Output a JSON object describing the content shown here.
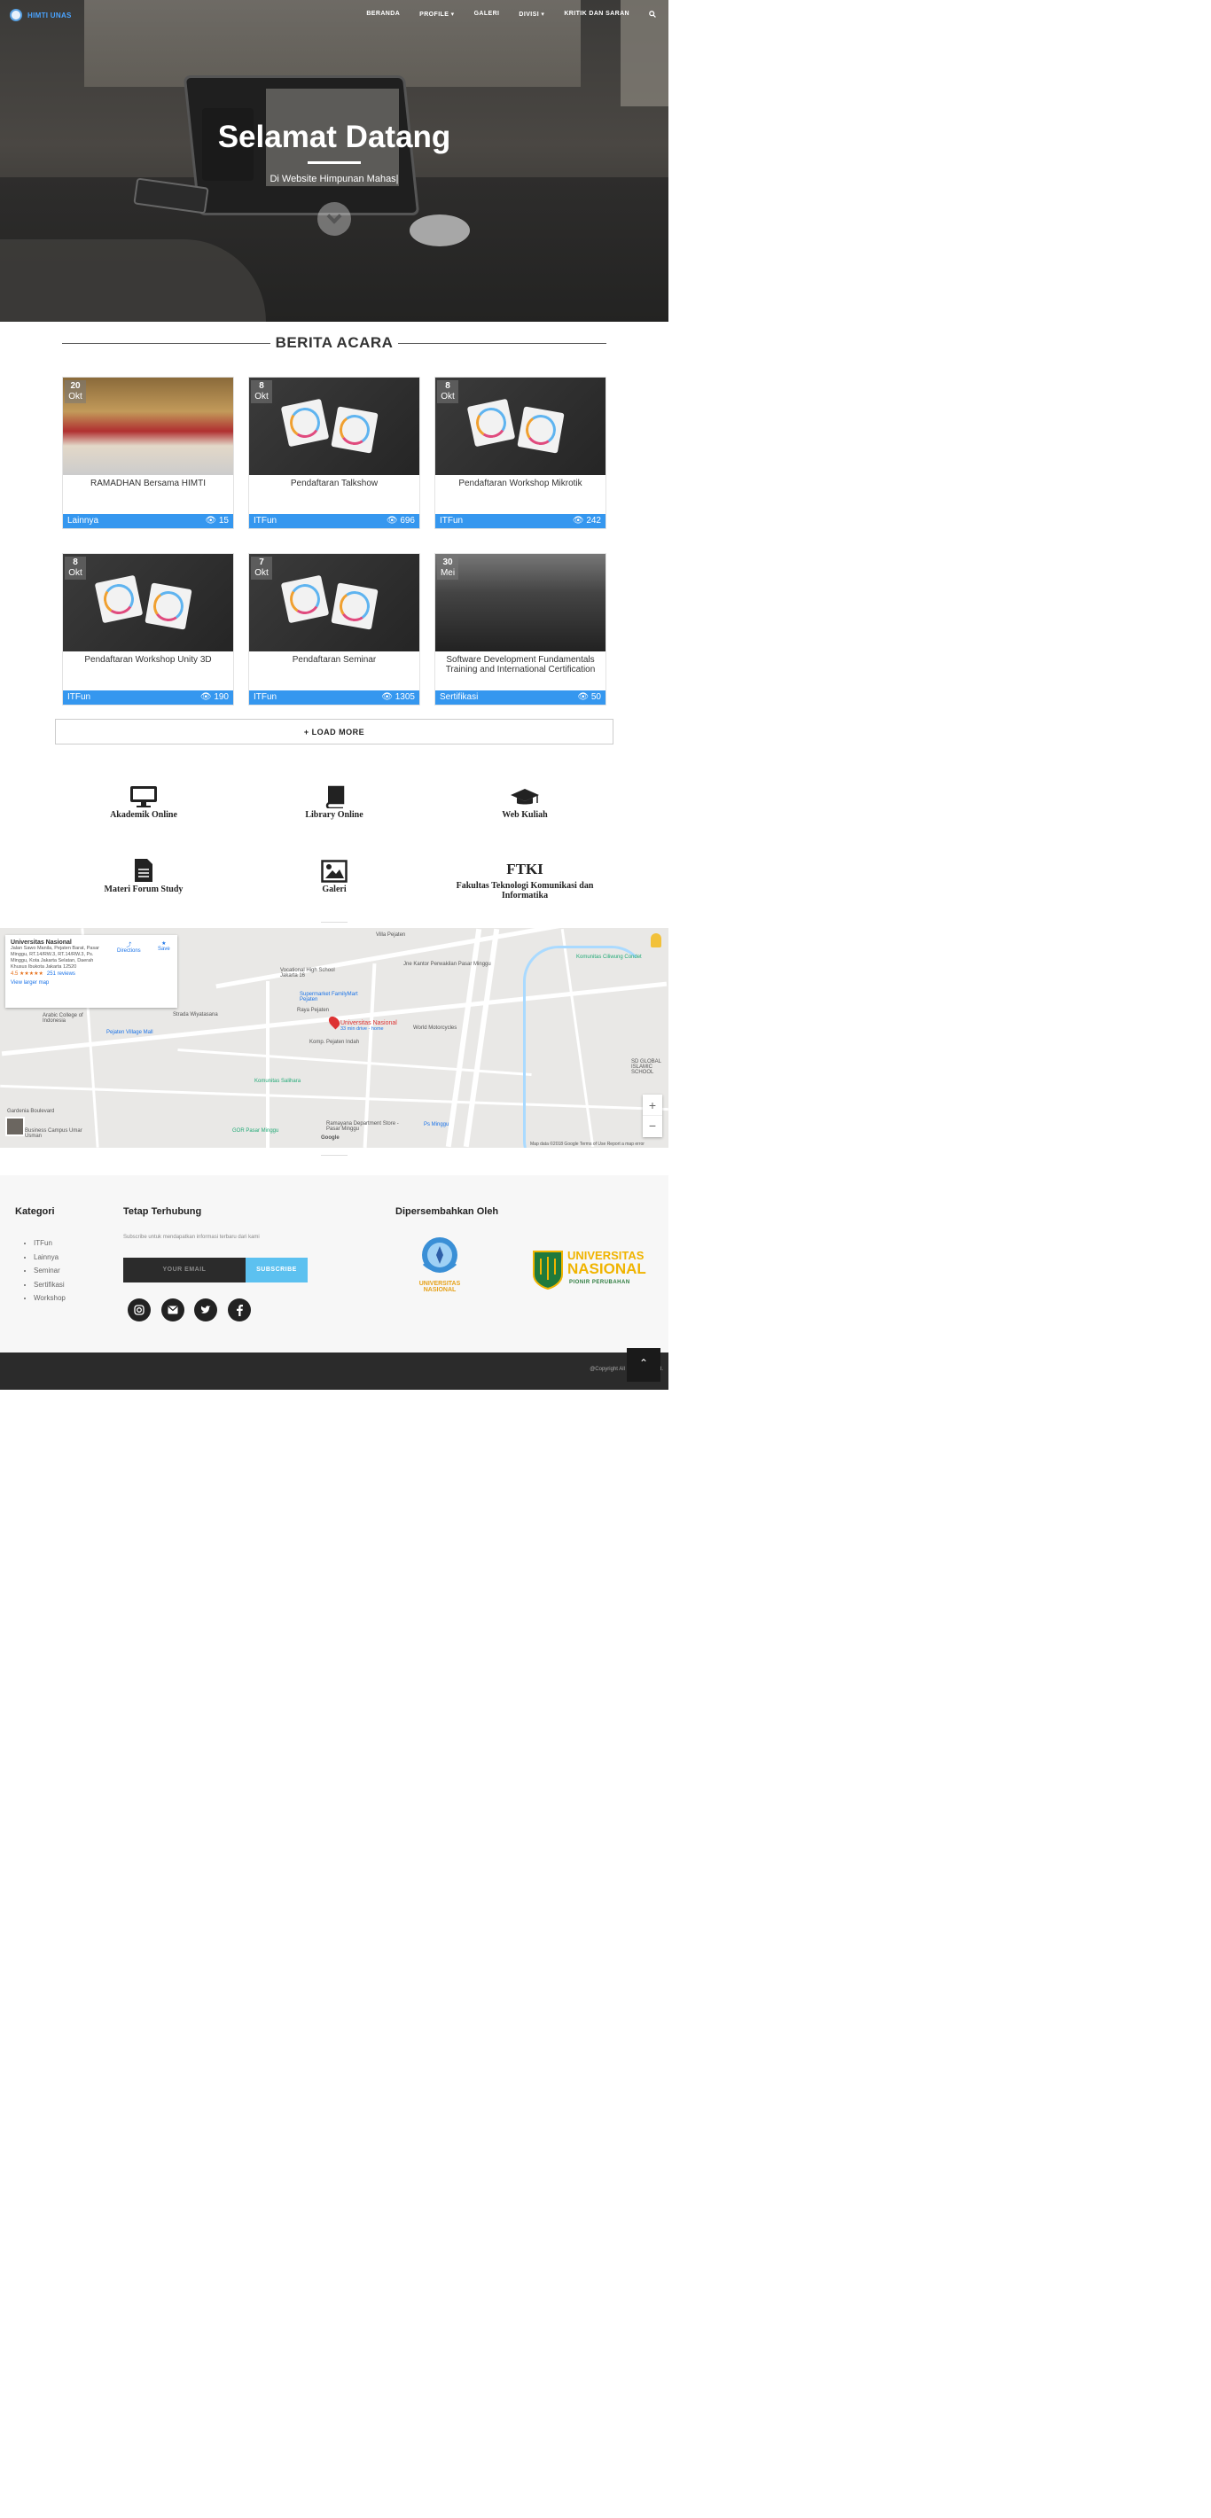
{
  "nav": {
    "brand": "HIMTI UNAS",
    "items": [
      {
        "label": "BERANDA"
      },
      {
        "label": "PROFILE ▾"
      },
      {
        "label": "GALERI"
      },
      {
        "label": "DIVISI ▾"
      },
      {
        "label": "KRITIK DAN SARAN"
      }
    ]
  },
  "hero": {
    "title": "Selamat Datang",
    "subtitle": "Di Website Himpunan Mahas|"
  },
  "berita": {
    "heading": "BERITA ACARA",
    "cards": [
      {
        "day": "20",
        "month": "Okt",
        "title": "RAMADHAN Bersama HIMTI",
        "category": "Lainnya",
        "views": "15",
        "image": "ramadhan"
      },
      {
        "day": "8",
        "month": "Okt",
        "title": "Pendaftaran Talkshow",
        "category": "ITFun",
        "views": "696",
        "image": "itfun"
      },
      {
        "day": "8",
        "month": "Okt",
        "title": "Pendaftaran Workshop Mikrotik",
        "category": "ITFun",
        "views": "242",
        "image": "itfun"
      },
      {
        "day": "8",
        "month": "Okt",
        "title": "Pendaftaran Workshop Unity 3D",
        "category": "ITFun",
        "views": "190",
        "image": "itfun"
      },
      {
        "day": "7",
        "month": "Okt",
        "title": "Pendaftaran Seminar",
        "category": "ITFun",
        "views": "1305",
        "image": "itfun"
      },
      {
        "day": "30",
        "month": "Mei",
        "title": "Software Development Fundamentals Training and International Certification",
        "category": "Sertifikasi",
        "views": "50",
        "image": "lab"
      }
    ],
    "load_more": "+ LOAD MORE"
  },
  "services": [
    {
      "label": "Akademik Online",
      "icon": "monitor-icon"
    },
    {
      "label": "Library Online",
      "icon": "book-icon"
    },
    {
      "label": "Web Kuliah",
      "icon": "graduation-cap-icon"
    },
    {
      "label": "Materi Forum Study",
      "icon": "document-icon"
    },
    {
      "label": "Galeri",
      "icon": "image-icon"
    },
    {
      "label": "Fakultas Teknologi Komunikasi dan Informatika",
      "icon": "ftki-text",
      "big": "FTKI"
    }
  ],
  "map": {
    "place": "Universitas Nasional",
    "address": "Jalan Sawo Manila, Pejaten Barat, Pasar Minggu, RT.14/RW.3, RT.14/RW.3, Ps. Minggu, Kota Jakarta Selatan, Daerah Khusus Ibukota Jakarta 12520",
    "rating": "4.5 ★★★★★",
    "reviews": "251 reviews",
    "larger": "View larger map",
    "directions": "Directions",
    "save": "Save",
    "pin_label": "Universitas Nasional",
    "pin_sub": "33 min drive - home",
    "footer_note": "Map data ©2018 Google   Terms of Use   Report a map error",
    "labels": [
      "Villa Pejaten",
      "Vocational High School Jakarta 16",
      "Jne Kantor Perwakilan Pasar Minggu",
      "Komunitas Ciliwung Condet",
      "Supermarket FamilyMart Pejaten",
      "Raya Pejaten",
      "Strada Wiyatasana",
      "Pejaten Village Mall",
      "World Motorcycles",
      "Komp. Pejaten Indah",
      "Komunitas Salihara",
      "GOR Pasar Minggu",
      "Ramayana Department Store - Pasar Minggu",
      "Ps Minggu",
      "Gardenia Boulevard",
      "Arabic College of Indonesia",
      "Business Campus Umar Usman",
      "Google",
      "SD GLOBAL ISLAMIC SCHOOL"
    ]
  },
  "footer": {
    "kategori_title": "Kategori",
    "kategori": [
      "ITFun",
      "Lainnya",
      "Seminar",
      "Sertifikasi",
      "Workshop"
    ],
    "contact_title": "Tetap Terhubung",
    "contact_text": "Subscribe untuk mendapatkan informasi terbaru dari kami",
    "email_placeholder": "YOUR EMAIL",
    "subscribe": "SUBSCRIBE",
    "sponsor_title": "Dipersembahkan Oleh",
    "logo1_text": "UNIVERSITAS NASIONAL",
    "logo2_line1": "UNIVERSITAS",
    "logo2_line2": "NASIONAL",
    "logo2_line3": "PIONIR PERUBAHAN",
    "copyright": "@Copyright All rights reserved."
  },
  "colors": {
    "accent": "#3597ef",
    "subscribe": "#5cc1f0",
    "brand": "#4aa3ff"
  }
}
